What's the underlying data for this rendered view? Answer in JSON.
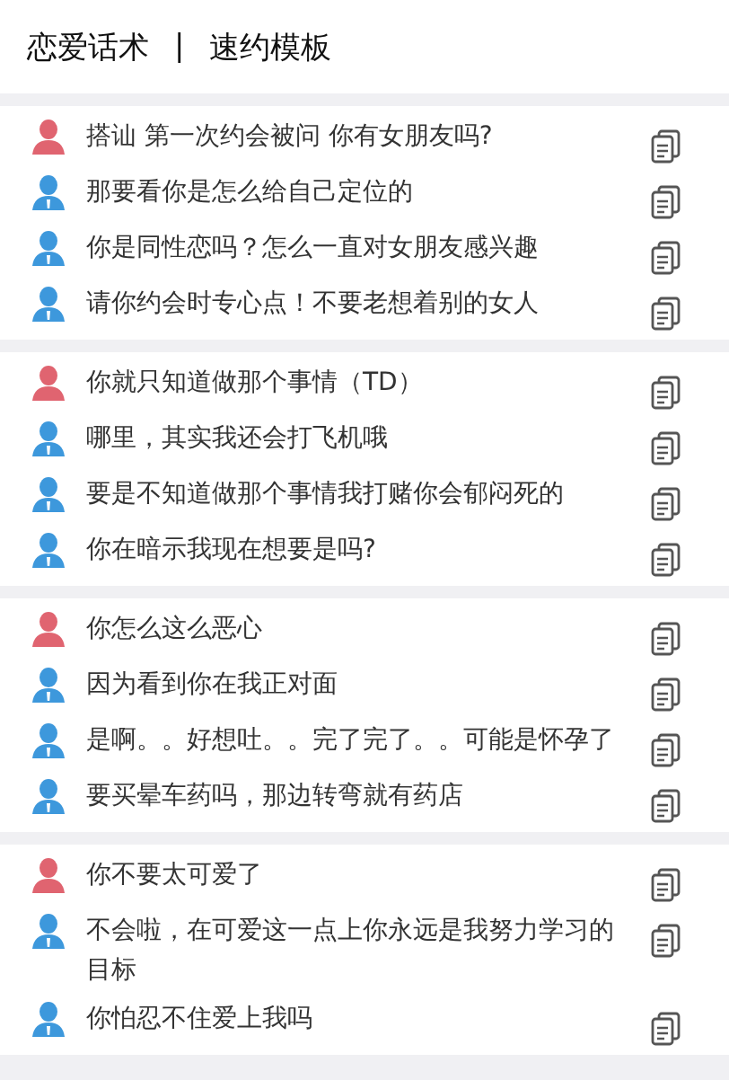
{
  "header": {
    "title": "恋爱话术",
    "separator": "|",
    "subtitle": "速约模板"
  },
  "groups": [
    {
      "lines": [
        {
          "kind": "female",
          "text": "搭讪  第一次约会被问 你有女朋友吗?"
        },
        {
          "kind": "male",
          "text": "那要看你是怎么给自己定位的"
        },
        {
          "kind": "male",
          "text": "你是同性恋吗？怎么一直对女朋友感兴趣"
        },
        {
          "kind": "male",
          "text": "请你约会时专心点！不要老想着别的女人"
        }
      ]
    },
    {
      "lines": [
        {
          "kind": "female",
          "text": "你就只知道做那个事情（TD）"
        },
        {
          "kind": "male",
          "text": "哪里，其实我还会打飞机哦"
        },
        {
          "kind": "male",
          "text": "要是不知道做那个事情我打赌你会郁闷死的"
        },
        {
          "kind": "male",
          "text": "你在暗示我现在想要是吗?"
        }
      ]
    },
    {
      "lines": [
        {
          "kind": "female",
          "text": "你怎么这么恶心"
        },
        {
          "kind": "male",
          "text": "因为看到你在我正对面"
        },
        {
          "kind": "male",
          "text": "是啊。。好想吐。。完了完了。。可能是怀孕了"
        },
        {
          "kind": "male",
          "text": "要买晕车药吗，那边转弯就有药店"
        }
      ]
    },
    {
      "lines": [
        {
          "kind": "female",
          "text": "你不要太可爱了"
        },
        {
          "kind": "male",
          "text": "不会啦，在可爱这一点上你永远是我努力学习的目标"
        },
        {
          "kind": "male",
          "text": "你怕忍不住爱上我吗"
        }
      ]
    }
  ]
}
